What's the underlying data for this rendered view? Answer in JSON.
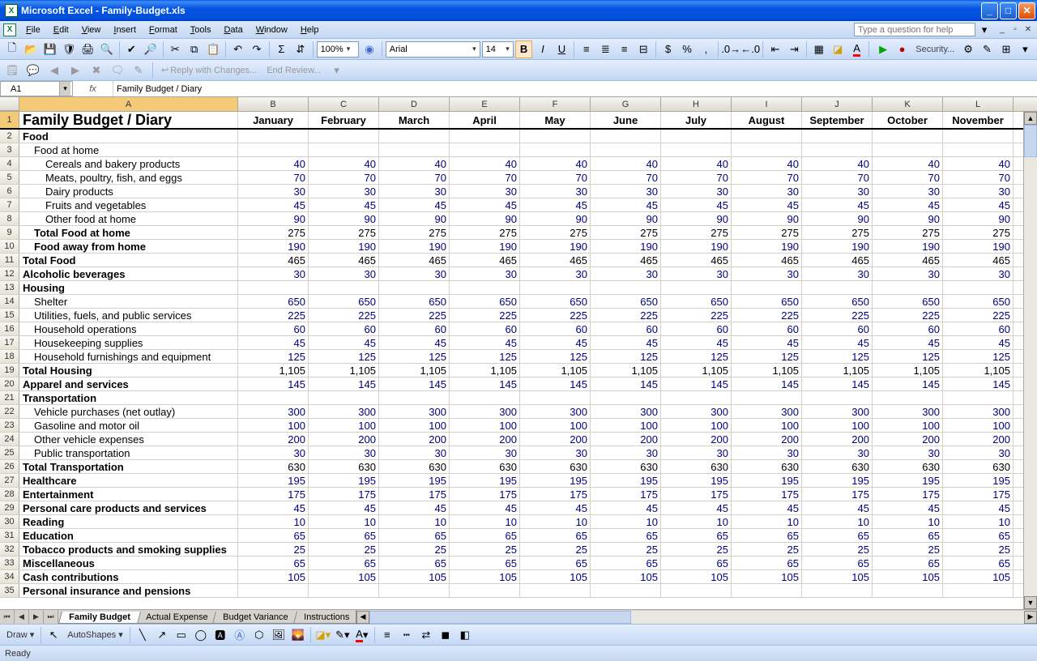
{
  "app": {
    "title": "Microsoft Excel - Family-Budget.xls"
  },
  "menu": [
    "File",
    "Edit",
    "View",
    "Insert",
    "Format",
    "Tools",
    "Data",
    "Window",
    "Help"
  ],
  "help_placeholder": "Type a question for help",
  "toolbar": {
    "zoom": "100%",
    "font": "Arial",
    "font_size": "14",
    "security": "Security..."
  },
  "review": {
    "reply": "Reply with Changes...",
    "end": "End Review..."
  },
  "namebox": "A1",
  "formula": "Family Budget / Diary",
  "columns": [
    "A",
    "B",
    "C",
    "D",
    "E",
    "F",
    "G",
    "H",
    "I",
    "J",
    "K",
    "L"
  ],
  "months": [
    "January",
    "February",
    "March",
    "April",
    "May",
    "June",
    "July",
    "August",
    "September",
    "October",
    "November"
  ],
  "rows": [
    {
      "n": 1,
      "a": "Family Budget / Diary",
      "type": "title"
    },
    {
      "n": 2,
      "a": "Food",
      "bold": true
    },
    {
      "n": 3,
      "a": "Food at home",
      "indent": 1
    },
    {
      "n": 4,
      "a": "Cereals and bakery products",
      "indent": 2,
      "v": 40
    },
    {
      "n": 5,
      "a": "Meats, poultry, fish, and eggs",
      "indent": 2,
      "v": 70
    },
    {
      "n": 6,
      "a": "Dairy products",
      "indent": 2,
      "v": 30
    },
    {
      "n": 7,
      "a": "Fruits and vegetables",
      "indent": 2,
      "v": 45
    },
    {
      "n": 8,
      "a": "Other food at home",
      "indent": 2,
      "v": 90
    },
    {
      "n": 9,
      "a": "Total Food at home",
      "indent": 1,
      "bold": true,
      "v": 275,
      "black": true
    },
    {
      "n": 10,
      "a": "Food away from home",
      "indent": 1,
      "bold": true,
      "v": 190
    },
    {
      "n": 11,
      "a": "Total Food",
      "bold": true,
      "v": 465,
      "black": true
    },
    {
      "n": 12,
      "a": "Alcoholic beverages",
      "bold": true,
      "v": 30
    },
    {
      "n": 13,
      "a": "Housing",
      "bold": true
    },
    {
      "n": 14,
      "a": "Shelter",
      "indent": 1,
      "v": 650
    },
    {
      "n": 15,
      "a": "Utilities, fuels, and public services",
      "indent": 1,
      "v": 225
    },
    {
      "n": 16,
      "a": "Household operations",
      "indent": 1,
      "v": 60
    },
    {
      "n": 17,
      "a": "Housekeeping supplies",
      "indent": 1,
      "v": 45
    },
    {
      "n": 18,
      "a": "Household furnishings and equipment",
      "indent": 1,
      "v": 125
    },
    {
      "n": 19,
      "a": "Total Housing",
      "bold": true,
      "v": "1,105",
      "black": true
    },
    {
      "n": 20,
      "a": "Apparel and services",
      "bold": true,
      "v": 145
    },
    {
      "n": 21,
      "a": "Transportation",
      "bold": true
    },
    {
      "n": 22,
      "a": "Vehicle purchases (net outlay)",
      "indent": 1,
      "v": 300
    },
    {
      "n": 23,
      "a": "Gasoline and motor oil",
      "indent": 1,
      "v": 100
    },
    {
      "n": 24,
      "a": "Other vehicle expenses",
      "indent": 1,
      "v": 200
    },
    {
      "n": 25,
      "a": "Public transportation",
      "indent": 1,
      "v": 30
    },
    {
      "n": 26,
      "a": "Total Transportation",
      "bold": true,
      "v": 630,
      "black": true
    },
    {
      "n": 27,
      "a": "Healthcare",
      "bold": true,
      "v": 195
    },
    {
      "n": 28,
      "a": "Entertainment",
      "bold": true,
      "v": 175
    },
    {
      "n": 29,
      "a": "Personal care products and services",
      "bold": true,
      "v": 45
    },
    {
      "n": 30,
      "a": "Reading",
      "bold": true,
      "v": 10
    },
    {
      "n": 31,
      "a": "Education",
      "bold": true,
      "v": 65
    },
    {
      "n": 32,
      "a": "Tobacco products and smoking supplies",
      "bold": true,
      "v": 25
    },
    {
      "n": 33,
      "a": "Miscellaneous",
      "bold": true,
      "v": 65
    },
    {
      "n": 34,
      "a": "Cash contributions",
      "bold": true,
      "v": 105
    },
    {
      "n": 35,
      "a": "Personal insurance and pensions",
      "bold": true
    }
  ],
  "sheets": [
    "Family Budget",
    "Actual Expense",
    "Budget Variance",
    "Instructions"
  ],
  "active_sheet": 0,
  "draw_label": "Draw",
  "autoshapes": "AutoShapes",
  "status": "Ready"
}
